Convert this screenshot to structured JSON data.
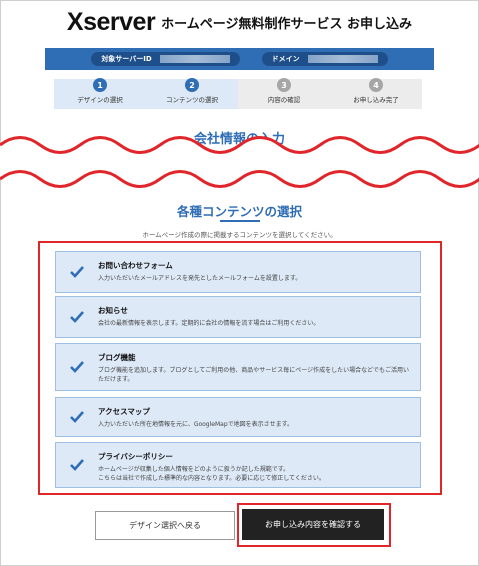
{
  "header": {
    "logo": "Xserver",
    "title": "ホームページ無料制作サービス お申し込み"
  },
  "idbar": {
    "server_id_label": "対象サーバーID",
    "domain_label": "ドメイン"
  },
  "steps": [
    {
      "num": "1",
      "label": "デザインの選択",
      "state": "active"
    },
    {
      "num": "2",
      "label": "コンテンツの選択",
      "state": "active"
    },
    {
      "num": "3",
      "label": "内容の確認",
      "state": "inactive"
    },
    {
      "num": "4",
      "label": "お申し込み完了",
      "state": "inactive"
    }
  ],
  "cut_section_title": "会社情報の入力",
  "contents": {
    "title": "各種コンテンツの選択",
    "description": "ホームページ作成の際に掲載するコンテンツを選択してください。",
    "items": [
      {
        "title": "お問い合わせフォーム",
        "desc": "入力いただいたメールアドレスを発先としたメールフォームを設置します。",
        "checked": true
      },
      {
        "title": "お知らせ",
        "desc": "会社の最新情報を表示します。定期的に会社の情報を流す場合はご利用ください。",
        "checked": true
      },
      {
        "title": "ブログ機能",
        "desc": "ブログ機能を追加します。ブログとしてご利用の他、商品やサービス毎にページ作成をしたい場合などでもご活用いただけます。",
        "checked": true
      },
      {
        "title": "アクセスマップ",
        "desc": "入力いただいた所在地情報を元に、GoogleMapで地図を表示させます。",
        "checked": true
      },
      {
        "title": "プライバシーポリシー",
        "desc": "ホームページが収集した個人情報をどのように扱うか記した規範です。\nこちらは当社で作成した標準的な内容となります。必要に応じて修正してください。",
        "checked": true
      }
    ]
  },
  "buttons": {
    "back": "デザイン選択へ戻る",
    "confirm": "お申し込み内容を確認する"
  },
  "colors": {
    "accent": "#2f6db5",
    "highlight": "#e0262b",
    "item_bg": "#dde9f7"
  }
}
